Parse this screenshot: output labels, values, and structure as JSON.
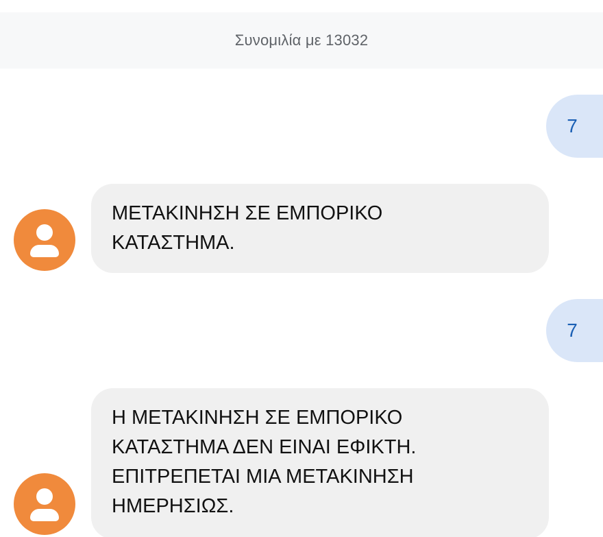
{
  "header": {
    "title": "Συνομιλία με 13032"
  },
  "messages": [
    {
      "direction": "outgoing",
      "text": "7"
    },
    {
      "direction": "incoming",
      "text": "ΜΕΤΑΚΙΝΗΣΗ ΣΕ ΕΜΠΟΡΙΚΟ\nΚΑΤΑΣΤΗΜΑ."
    },
    {
      "direction": "outgoing",
      "text": "7"
    },
    {
      "direction": "incoming",
      "text": "Η ΜΕΤΑΚΙΝΗΣΗ ΣΕ ΕΜΠΟΡΙΚΟ\nΚΑΤΑΣΤΗΜΑ ΔΕΝ ΕΙΝΑΙ ΕΦΙΚΤΗ.\nΕΠΙΤΡΕΠΕΤΑΙ ΜΙΑ ΜΕΤΑΚΙΝΗΣΗ\nΗΜΕΡΗΣΙΩΣ."
    }
  ],
  "icons": {
    "avatar": "person-icon"
  },
  "colors": {
    "header_bg": "#f7f8f9",
    "outgoing_bubble": "#dae6f8",
    "outgoing_text": "#1a5fb4",
    "incoming_bubble": "#f0f0f0",
    "avatar": "#f08a3c"
  }
}
